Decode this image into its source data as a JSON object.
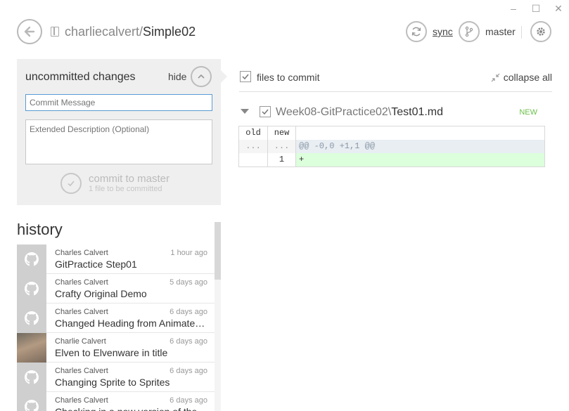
{
  "window": {
    "minimize": "–",
    "maximize": "☐",
    "close": "✕"
  },
  "header": {
    "repo_owner": "charliecalvert/",
    "repo_name": "Simple02",
    "sync_label": "sync",
    "branch_label": "master"
  },
  "commit_panel": {
    "title": "uncommitted changes",
    "hide_label": "hide",
    "message_placeholder": "Commit Message",
    "description_placeholder": "Extended Description (Optional)",
    "commit_label": "commit to master",
    "commit_subtitle": "1 file to be committed"
  },
  "history": {
    "title": "history",
    "items": [
      {
        "author": "Charles Calvert",
        "time": "1 hour ago",
        "summary": "GitPractice Step01",
        "avatar": "github-octocat-icon"
      },
      {
        "author": "Charles Calvert",
        "time": "5 days ago",
        "summary": "Crafty Original Demo",
        "avatar": "github-octocat-icon"
      },
      {
        "author": "Charles Calvert",
        "time": "6 days ago",
        "summary": "Changed Heading from Animate…",
        "avatar": "github-octocat-icon"
      },
      {
        "author": "Charlie Calvert",
        "time": "6 days ago",
        "summary": "Elven to Elvenware in title",
        "avatar": "user-photo"
      },
      {
        "author": "Charles Calvert",
        "time": "6 days ago",
        "summary": "Changing Sprite to Sprites",
        "avatar": "github-octocat-icon"
      },
      {
        "author": "Charles Calvert",
        "time": "6 days ago",
        "summary": "Checking in a new version of the code",
        "avatar": "github-octocat-icon"
      }
    ]
  },
  "files": {
    "header_label": "files to commit",
    "collapse_label": "collapse all",
    "file_dir": "Week08-GitPractice02\\",
    "file_name": "Test01.md",
    "badge": "NEW"
  },
  "diff": {
    "col_old": "old",
    "col_new": "new",
    "rows": [
      {
        "old": "...",
        "new": "...",
        "text": "@@ -0,0 +1,1 @@"
      },
      {
        "old": "",
        "new": "1",
        "text": "+"
      }
    ]
  }
}
